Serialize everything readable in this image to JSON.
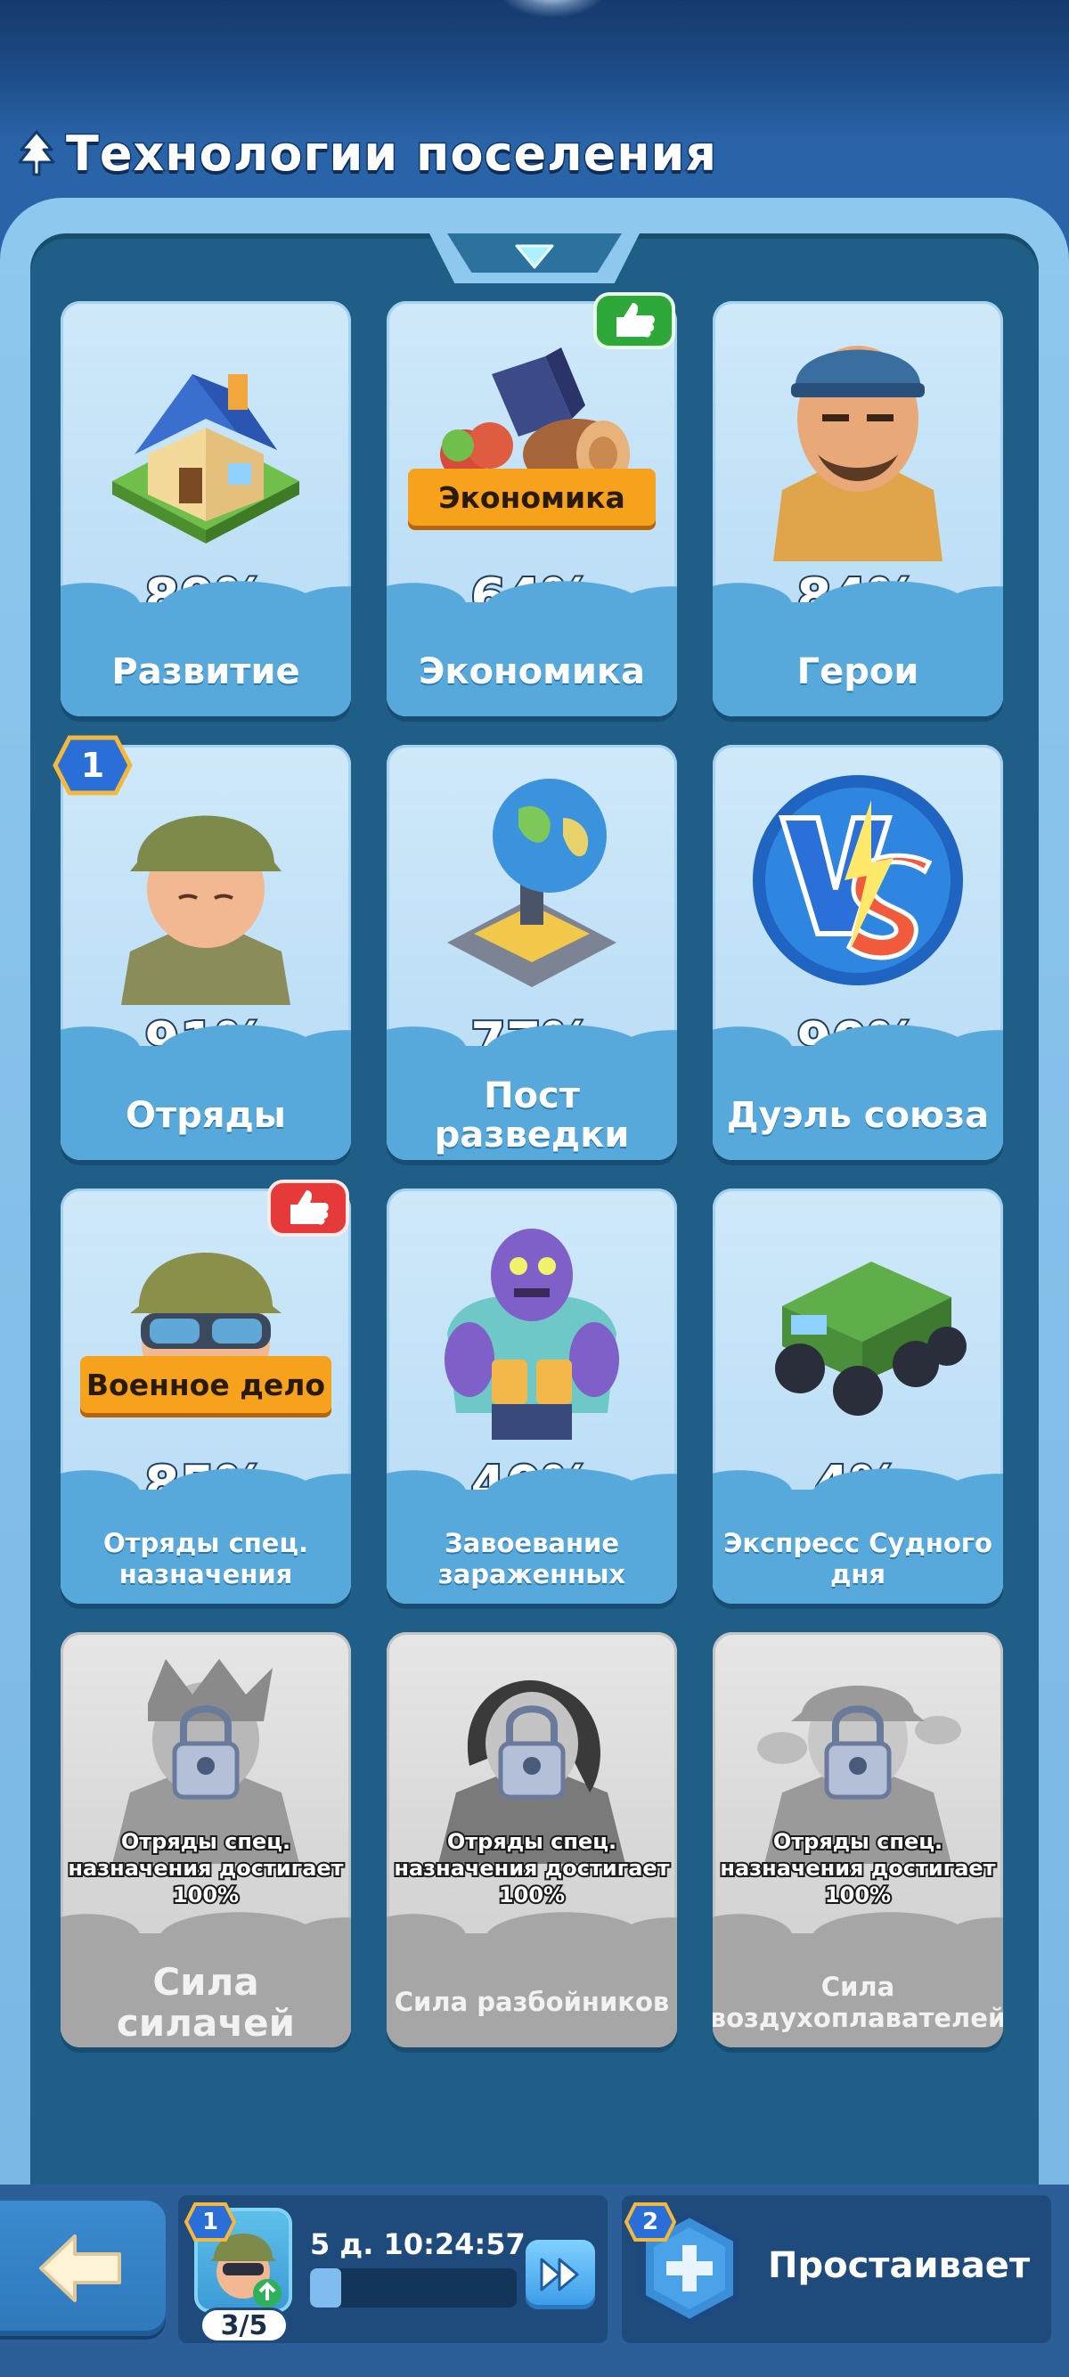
{
  "header": {
    "title": "Технологии поселения"
  },
  "techs": [
    {
      "id": "development",
      "name": "Развитие",
      "percent": "89%",
      "icon": "house-icon"
    },
    {
      "id": "economy",
      "name": "Экономика",
      "percent": "64%",
      "icon": "resources-icon",
      "ribbon": "Экономика",
      "badge": "thumbs-up-green"
    },
    {
      "id": "heroes",
      "name": "Герои",
      "percent": "84%",
      "icon": "hero-portrait-icon"
    },
    {
      "id": "squads",
      "name": "Отряды",
      "percent": "91%",
      "icon": "soldier-icon",
      "num_badge": "1"
    },
    {
      "id": "recon",
      "name": "Пост разведки",
      "percent": "77%",
      "icon": "radar-globe-icon"
    },
    {
      "id": "alliance-duel",
      "name": "Дуэль союза",
      "percent": "90%",
      "icon": "vs-icon"
    },
    {
      "id": "special-forces",
      "name": "Отряды спец. назначения",
      "percent": "85%",
      "icon": "goggles-soldier-icon",
      "ribbon": "Военное дело",
      "badge": "thumbs-up-red"
    },
    {
      "id": "infected",
      "name": "Завоевание зараженных",
      "percent": "40%",
      "icon": "zombie-icon"
    },
    {
      "id": "doomsday",
      "name": "Экспресс Судного дня",
      "percent": "4%",
      "icon": "armored-truck-icon"
    }
  ],
  "locked": [
    {
      "id": "strongmen",
      "name": "Сила силачей",
      "requirement": "Отряды спец. назначения достигает 100%",
      "icon": "lock-icon"
    },
    {
      "id": "bandits",
      "name": "Сила разбойников",
      "requirement": "Отряды спец. назначения достигает 100%",
      "icon": "lock-icon"
    },
    {
      "id": "aeronauts",
      "name": "Сила воздухоплавателей",
      "requirement": "Отряды спец. назначения достигает 100%",
      "icon": "lock-icon"
    }
  ],
  "bottom": {
    "queue_badge": "1",
    "queue_count": "3/5",
    "timer": "5 д. 10:24:57",
    "progress": 0.15,
    "help_badge": "2",
    "help_label": "Простаивает"
  }
}
